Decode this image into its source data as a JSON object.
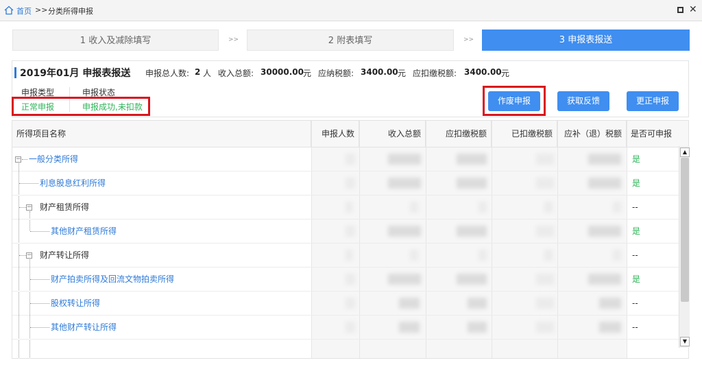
{
  "titlebar": {
    "home": "首页",
    "separator": ">>",
    "page": "分类所得申报"
  },
  "steps": [
    {
      "label": "1 收入及减除填写",
      "state": "done"
    },
    {
      "label": "2 附表填写",
      "state": "done"
    },
    {
      "label": "3 申报表报送",
      "state": "active"
    }
  ],
  "step_arrow": ">>",
  "header": {
    "title": "2019年01月  申报表报送",
    "people_label": "申报总人数:",
    "people_value": "2",
    "people_unit": "人",
    "income_label": "收入总额:",
    "income_value": "30000.00",
    "income_unit": "元",
    "tax_payable_label": "应纳税额:",
    "tax_payable_value": "3400.00",
    "tax_payable_unit": "元",
    "tax_withheld_label": "应扣缴税额:",
    "tax_withheld_value": "3400.00",
    "tax_withheld_unit": "元"
  },
  "declaration": {
    "type_label": "申报类型",
    "type_value": "正常申报",
    "status_label": "申报状态",
    "status_value": "申报成功,未扣款"
  },
  "buttons": {
    "void": "作废申报",
    "feedback": "获取反馈",
    "correct": "更正申报"
  },
  "table": {
    "columns": [
      "所得项目名称",
      "申报人数",
      "收入总额",
      "应扣缴税额",
      "已扣缴税额",
      "应补（退）税额",
      "是否可申报"
    ],
    "rows": [
      {
        "name": "一般分类所得",
        "can_declare": "是"
      },
      {
        "name": "利息股息红利所得",
        "can_declare": "是"
      },
      {
        "name": "财产租赁所得",
        "can_declare": "--"
      },
      {
        "name": "其他财产租赁所得",
        "can_declare": "是"
      },
      {
        "name": "财产转让所得",
        "can_declare": "--"
      },
      {
        "name": "财产拍卖所得及回流文物拍卖所得",
        "can_declare": "是"
      },
      {
        "name": "股权转让所得",
        "can_declare": "--"
      },
      {
        "name": "其他财产转让所得",
        "can_declare": "--"
      }
    ]
  },
  "colors": {
    "accent": "#3f8ef0",
    "link": "#2f7bd9",
    "success": "#2fb45a",
    "highlight": "#d9141c"
  }
}
